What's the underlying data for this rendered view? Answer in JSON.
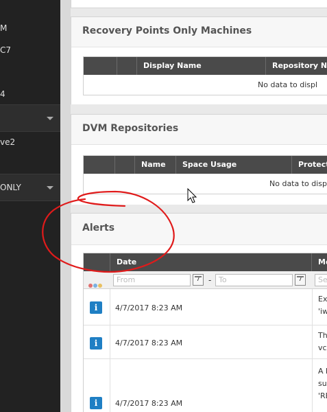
{
  "sidebar": {
    "items": [
      "M",
      "C7",
      "4",
      "ve2"
    ],
    "sections": [
      "",
      "ONLY"
    ]
  },
  "recovery_points_panel": {
    "title": "Recovery Points Only Machines",
    "columns": [
      "",
      "",
      "Display Name",
      "Repository Nam"
    ],
    "empty_text": "No data to displ"
  },
  "dvm_panel": {
    "title": "DVM Repositories",
    "columns": [
      "",
      "",
      "Name",
      "Space Usage",
      "Protecte"
    ],
    "empty_text": "No data to displ"
  },
  "alerts_panel": {
    "title": "Alerts",
    "columns": [
      "",
      "Date",
      "Me"
    ],
    "filter": {
      "from_placeholder": "From",
      "to_placeholder": "To",
      "search_placeholder": "Sea",
      "separator": "-",
      "calendar_icon_label": "7"
    },
    "rows": [
      {
        "icon": "i",
        "date": "4/7/2017 8:23 AM",
        "message": [
          "Exp",
          "'iws"
        ]
      },
      {
        "icon": "i",
        "date": "4/7/2017 8:23 AM",
        "message": [
          "The",
          "vce"
        ]
      },
      {
        "icon": "i",
        "date": "4/7/2017 8:23 AM",
        "message": [
          "A b",
          "sur",
          "'RE"
        ]
      }
    ]
  },
  "colors": {
    "sidebar_bg": "#222222",
    "table_header": "#4a4a4a",
    "info_icon": "#1f7fc4",
    "annotation": "#e01b1b"
  }
}
